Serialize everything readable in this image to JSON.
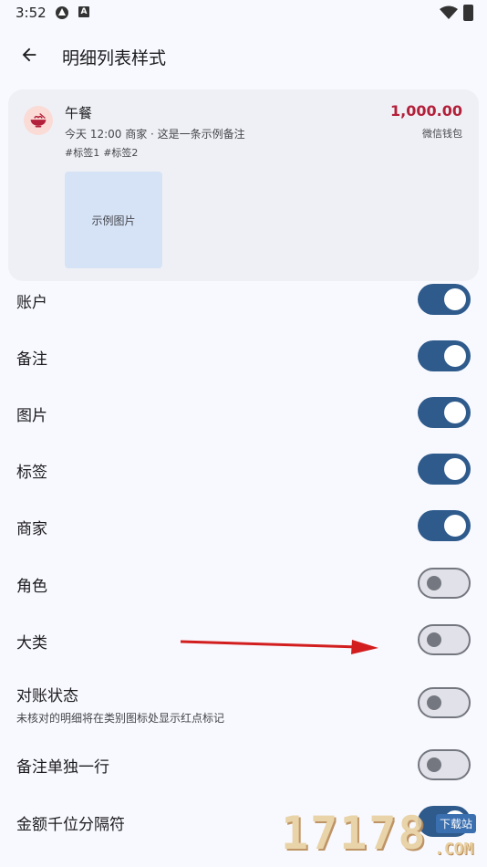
{
  "status_bar": {
    "time": "3:52",
    "icon_b_letter": "A"
  },
  "app_bar": {
    "title": "明细列表样式"
  },
  "preview": {
    "title": "午餐",
    "amount": "1,000.00",
    "subtitle": "今天 12:00 商家 · 这是一条示例备注",
    "account": "微信钱包",
    "tags": [
      "#标签1",
      "#标签2"
    ],
    "image_label": "示例图片"
  },
  "settings": [
    {
      "label": "账户",
      "on": true
    },
    {
      "label": "备注",
      "on": true
    },
    {
      "label": "图片",
      "on": true
    },
    {
      "label": "标签",
      "on": true
    },
    {
      "label": "商家",
      "on": true
    },
    {
      "label": "角色",
      "on": false
    },
    {
      "label": "大类",
      "on": false
    },
    {
      "label": "对账状态",
      "desc": "未核对的明细将在类别图标处显示红点标记",
      "on": false
    },
    {
      "label": "备注单独一行",
      "on": false
    },
    {
      "label": "金额千位分隔符",
      "on": true
    }
  ],
  "watermark": {
    "digits": "17178",
    "badge": "下载站",
    "domain": ".COM"
  },
  "colors": {
    "switch_on": "#2e5a8c",
    "amount": "#b3203a",
    "arrow": "#d21e1e"
  }
}
